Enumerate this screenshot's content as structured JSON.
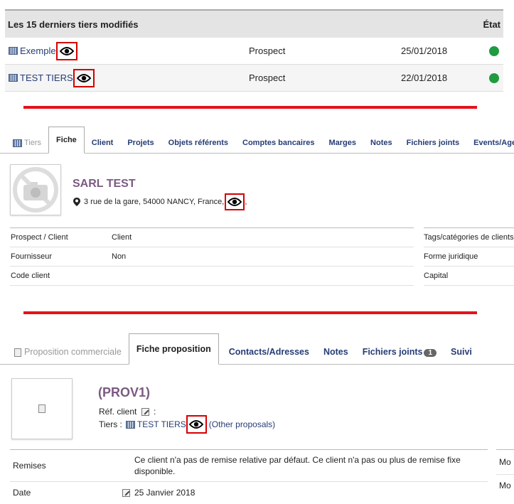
{
  "last_modified": {
    "title": "Les 15 derniers tiers modifiés",
    "state_col": "État",
    "rows": [
      {
        "name": "Exemple",
        "type": "Prospect",
        "date": "25/01/2018"
      },
      {
        "name": "TEST TIERS",
        "type": "Prospect",
        "date": "22/01/2018"
      }
    ]
  },
  "tiers_card": {
    "tabs": [
      "Tiers",
      "Fiche",
      "Client",
      "Projets",
      "Objets référents",
      "Comptes bancaires",
      "Marges",
      "Notes",
      "Fichiers joints",
      "Events/Agenda"
    ],
    "name": "SARL TEST",
    "address": "3 rue de la gare, 54000 NANCY, France,",
    "address_suffix": ",",
    "left_rows": [
      {
        "label": "Prospect / Client",
        "value": "Client"
      },
      {
        "label": "Fournisseur",
        "value": "Non"
      },
      {
        "label": "Code client",
        "value": ""
      }
    ],
    "right_rows": [
      "Tags/catégories de clients",
      "Forme juridique",
      "Capital"
    ]
  },
  "proposal_card": {
    "tabs": [
      "Proposition commerciale",
      "Fiche proposition",
      "Contacts/Adresses",
      "Notes",
      "Fichiers joints",
      "Suivi"
    ],
    "files_count": "1",
    "ref": "(PROV1)",
    "ref_client_label": "Réf. client",
    "ref_client_colon": ":",
    "tiers_label": "Tiers :",
    "tiers_name": "TEST TIERS",
    "other_proposals": "(Other proposals)",
    "rows": [
      {
        "label": "Remises",
        "value": "Ce client n'a pas de remise relative par défaut. Ce client n'a pas ou plus de remise fixe disponible."
      },
      {
        "label": "Date",
        "value": "25 Janvier 2018"
      }
    ],
    "right_cut": [
      "Mo",
      "Mo"
    ]
  },
  "colors": {
    "status_green": "#1f9b40",
    "highlight_red": "#d40000",
    "separator_red": "#e4131b",
    "link": "#263c76",
    "title_purple": "#7b5a82"
  }
}
